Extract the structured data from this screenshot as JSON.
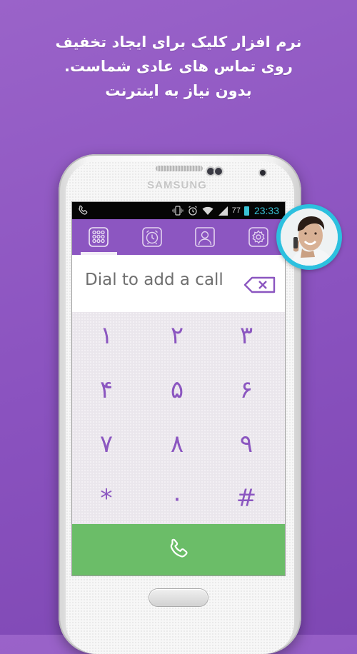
{
  "headline": {
    "line1": "نرم افزار کلیک برای ایجاد تخفیف",
    "line2": "روی تماس های عادی شماست.",
    "line3": "بدون نیاز به اینترنت"
  },
  "phone": {
    "brand": "SAMSUNG"
  },
  "statusbar": {
    "battery_percent": "77",
    "time": "23:33"
  },
  "tabs": [
    {
      "icon": "dialpad-icon",
      "active": true
    },
    {
      "icon": "alarm-clock-icon",
      "active": false
    },
    {
      "icon": "contact-icon",
      "active": false
    },
    {
      "icon": "settings-gear-icon",
      "active": false
    }
  ],
  "dialer": {
    "placeholder": "Dial to add a call",
    "keys": [
      "۱",
      "۲",
      "۳",
      "۴",
      "۵",
      "۶",
      "۷",
      "۸",
      "۹",
      "*",
      "۰",
      "#"
    ]
  },
  "colors": {
    "background": "#8a52bf",
    "tab_bar": "#8c56c1",
    "key_text": "#8b56c0",
    "call_button": "#6bbd68",
    "time_accent": "#39c2d6",
    "avatar_ring": "#2cc0df"
  }
}
